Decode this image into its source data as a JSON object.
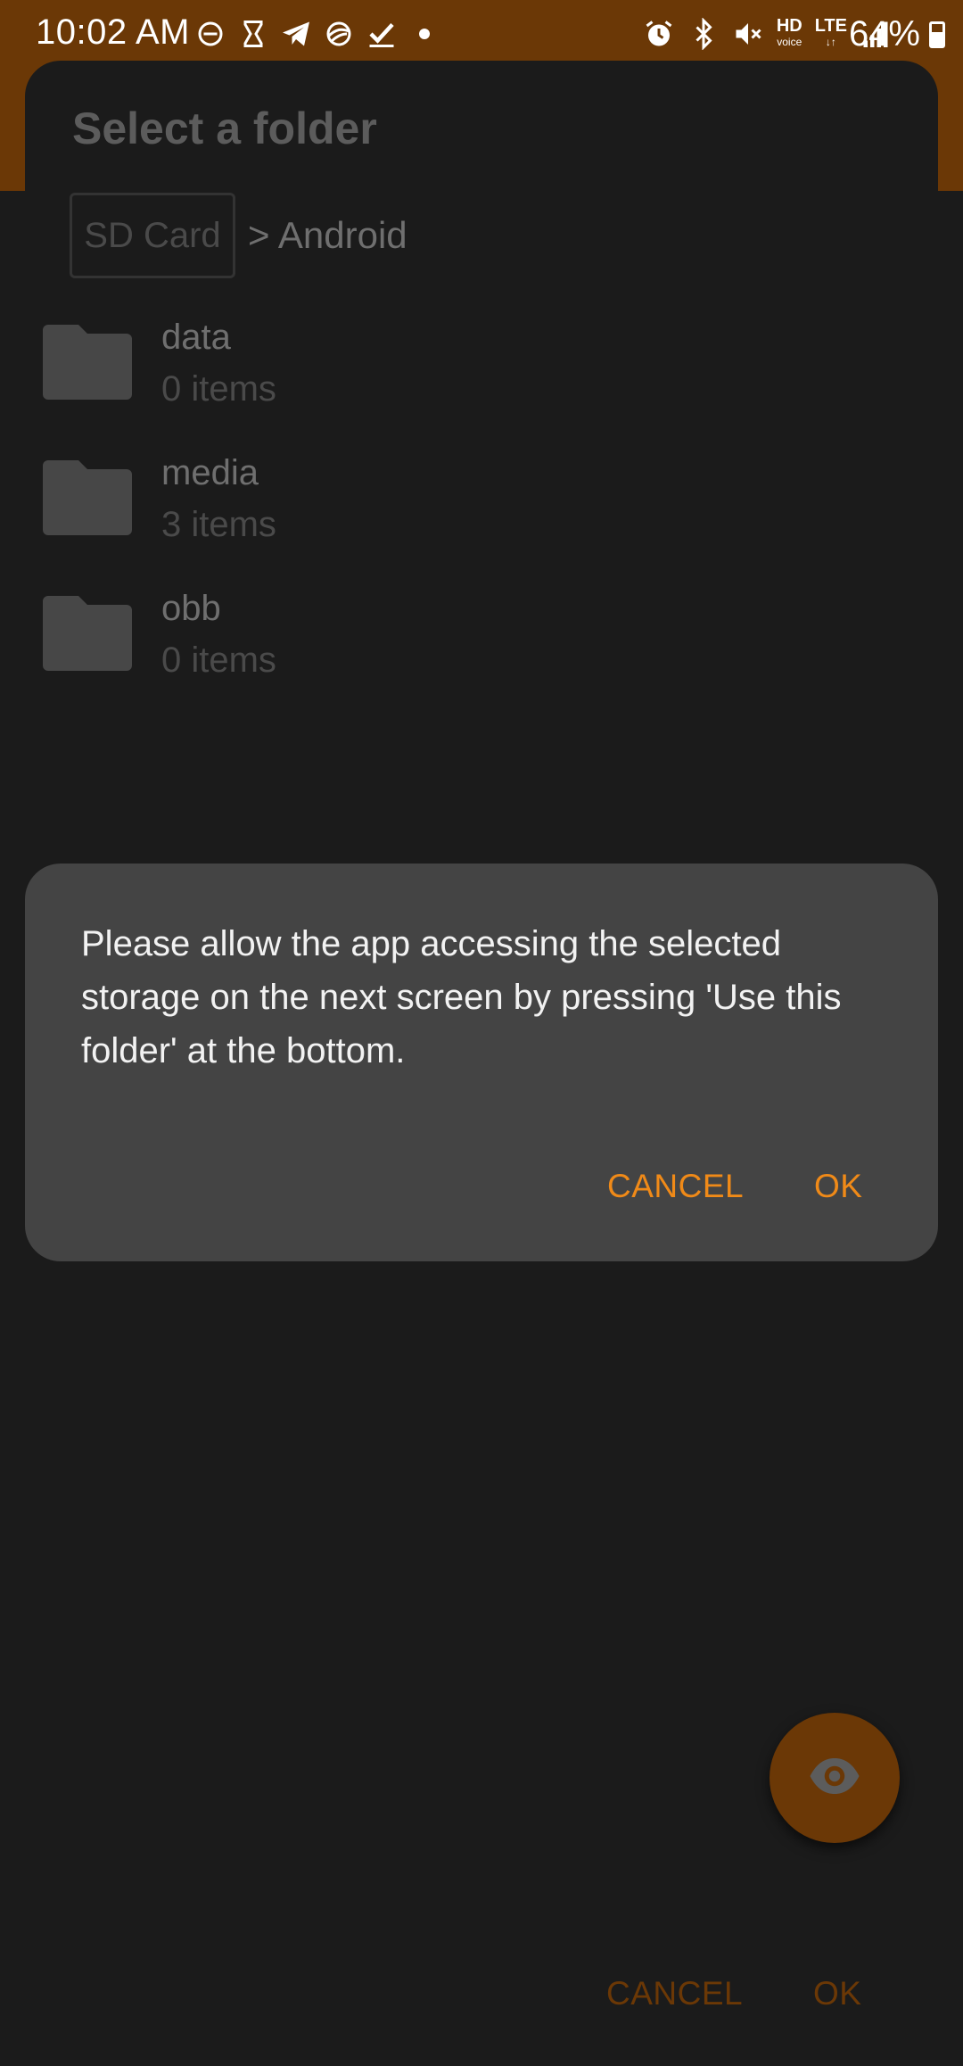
{
  "status_bar": {
    "time": "10:02 AM",
    "battery_text": "64%",
    "battery_level": 0.64,
    "left_icons": [
      "dnd-icon",
      "hourglass-icon",
      "telegram-icon",
      "vpn-icon",
      "task-check-icon",
      "dot-icon"
    ],
    "right_icons": [
      "alarm-icon",
      "bluetooth-icon",
      "mute-icon",
      "hd-voice-icon",
      "lte-icon",
      "signal-icon"
    ],
    "hd_label": "HD",
    "hd_sub": "voice",
    "lte_label": "LTE"
  },
  "colors": {
    "accent": "#f08a18",
    "accent_dim": "#6b3806",
    "background": "#1b1b1b",
    "dialog": "#444444"
  },
  "folder_picker": {
    "title": "Select a folder",
    "breadcrumb_root": "SD Card",
    "breadcrumb_path": "> Android",
    "folders": [
      {
        "name": "data",
        "count": "0 items"
      },
      {
        "name": "media",
        "count": "3 items"
      },
      {
        "name": "obb",
        "count": "0 items"
      }
    ],
    "fab_icon": "eye-icon",
    "cancel_label": "CANCEL",
    "ok_label": "OK"
  },
  "dialog": {
    "message": "Please allow the app accessing the selected storage on the next screen by pressing 'Use this folder' at the bottom.",
    "cancel_label": "CANCEL",
    "ok_label": "OK"
  }
}
